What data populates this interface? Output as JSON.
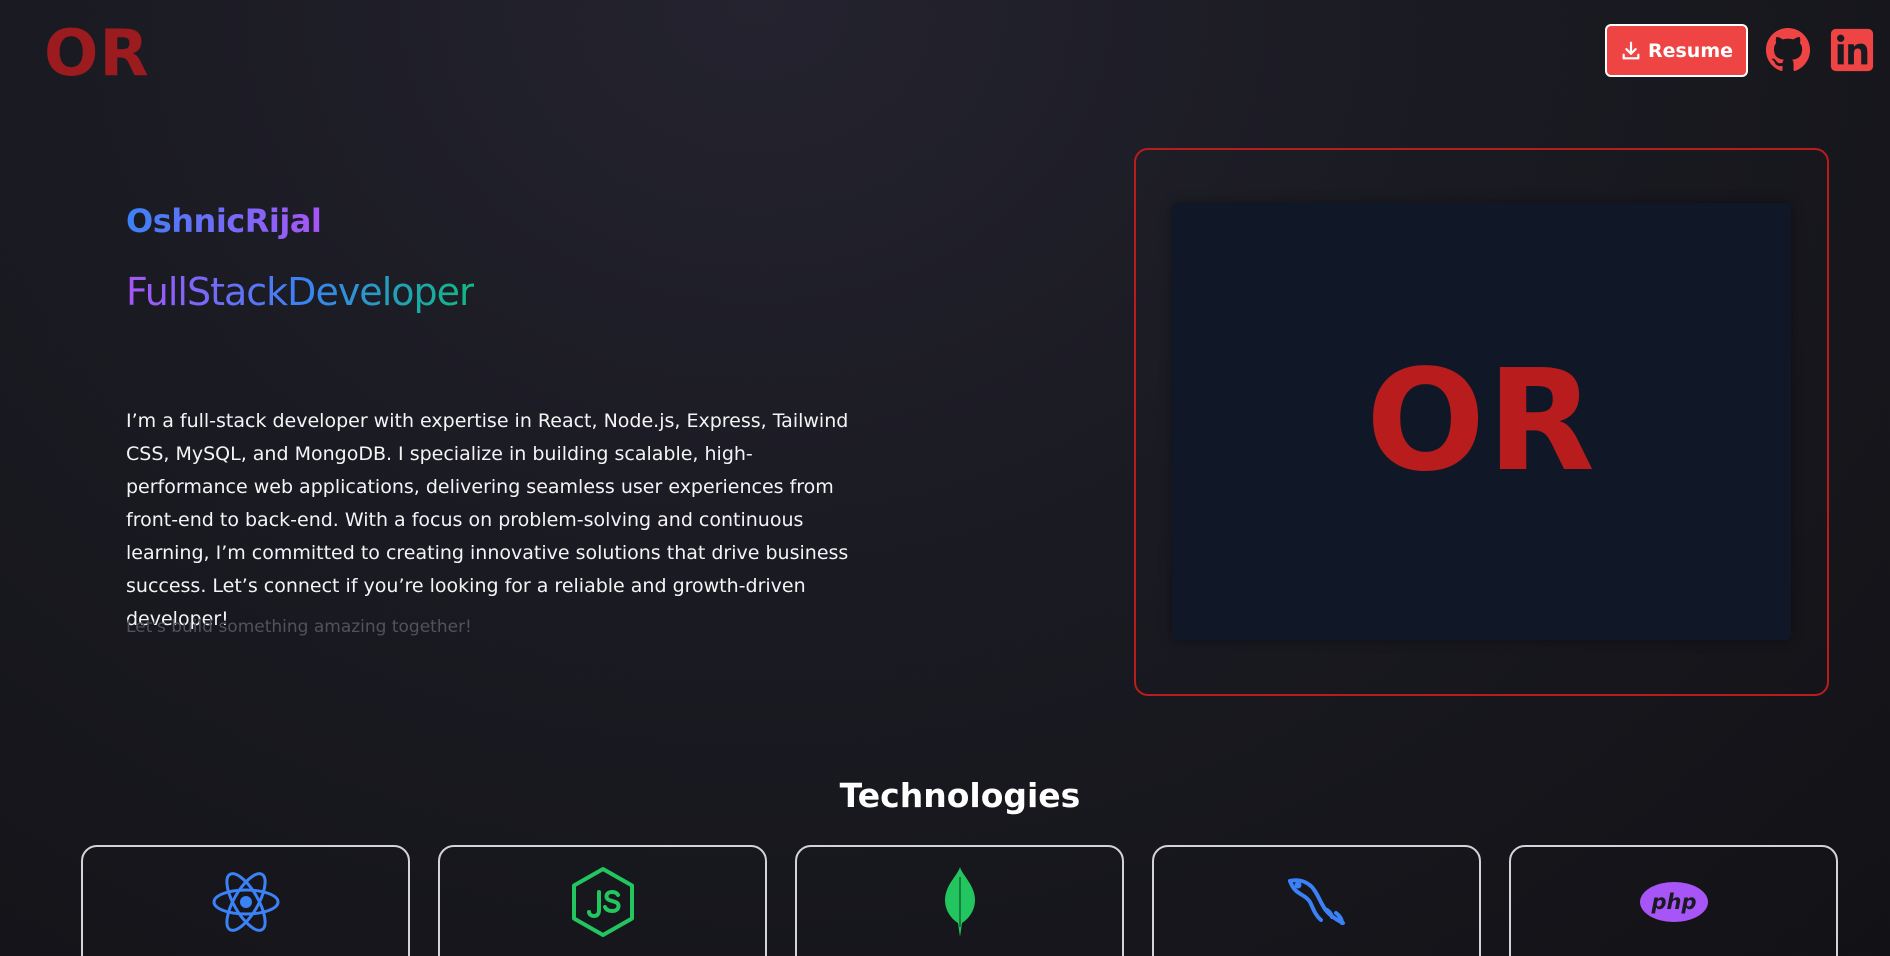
{
  "header": {
    "logo_text": "OR",
    "resume_label": "Resume",
    "icons": [
      "download-icon",
      "github-icon",
      "linkedin-icon"
    ]
  },
  "hero": {
    "name": "OshnicRijal",
    "role": "FullStackDeveloper",
    "bio": "I’m a full-stack developer with expertise in React, Node.js, Express, Tailwind CSS, MySQL, and MongoDB. I specialize in building scalable, high-performance web applications, delivering seamless user experiences from front-end to back-end. With a focus on problem-solving and continuous learning, I’m committed to creating innovative solutions that drive business success. Let’s connect if you’re looking for a reliable and growth-driven developer!",
    "tagline": "Let's build something amazing together!",
    "image_logo_text": "OR"
  },
  "technologies": {
    "title": "Technologies",
    "items": [
      {
        "icon": "react-icon",
        "color": "#3b82f6"
      },
      {
        "icon": "nodejs-icon",
        "color": "#22c55e"
      },
      {
        "icon": "mongodb-icon",
        "color": "#22c55e"
      },
      {
        "icon": "mysql-icon",
        "color": "#3b82f6"
      },
      {
        "icon": "php-icon",
        "color": "#a855f7"
      }
    ]
  },
  "colors": {
    "accent": "#ef4444",
    "brand_dark_red": "#9b1b1f",
    "hero_inner_bg": "#101828"
  }
}
